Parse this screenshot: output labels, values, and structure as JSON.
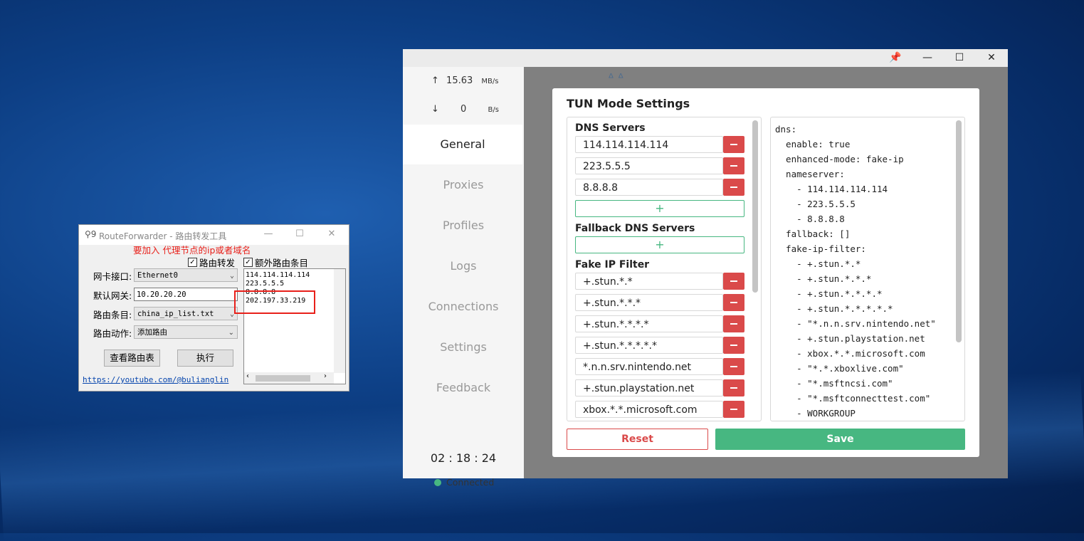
{
  "route_forwarder": {
    "title": "RouteForwarder - 路由转发工具",
    "annotation": "要加入 代理节点的ip或者域名",
    "checkbox_route_forward": "路由转发",
    "checkbox_extra_entries": "额外路由条目",
    "nic_label": "网卡接口:",
    "nic_value": "Ethernet0",
    "gateway_label": "默认网关:",
    "gateway_value": "10.20.20.20",
    "entries_label": "路由条目:",
    "entries_value": "china_ip_list.txt",
    "action_label": "路由动作:",
    "action_value": "添加路由",
    "extra_list": [
      "114.114.114.114",
      "223.5.5.5",
      "8.8.8.8",
      "202.197.33.219"
    ],
    "view_table_button": "查看路由表",
    "execute_button": "执行",
    "link": "https://youtube.com/@bulianglin"
  },
  "clash": {
    "speed_up": "15.63",
    "speed_up_unit": "MB/s",
    "speed_down": "0",
    "speed_down_unit": "B/s",
    "nav": [
      "General",
      "Proxies",
      "Profiles",
      "Logs",
      "Connections",
      "Settings",
      "Feedback"
    ],
    "active_nav": "General",
    "clock": "02 : 18 : 24",
    "status": "Connected",
    "modal": {
      "title": "TUN Mode Settings",
      "dns_servers_label": "DNS Servers",
      "dns_servers": [
        "114.114.114.114",
        "223.5.5.5",
        "8.8.8.8"
      ],
      "fallback_label": "Fallback DNS Servers",
      "fake_ip_filter_label": "Fake IP Filter",
      "fake_ip_filter": [
        "+.stun.*.*",
        "+.stun.*.*.*",
        "+.stun.*.*.*.*",
        "+.stun.*.*.*.*.*",
        "*.n.n.srv.nintendo.net",
        "+.stun.playstation.net",
        "xbox.*.*.microsoft.com"
      ],
      "plus_symbol": "+",
      "yaml_lines": [
        "dns:",
        "  enable: true",
        "  enhanced-mode: fake-ip",
        "  nameserver:",
        "    - 114.114.114.114",
        "    - 223.5.5.5",
        "    - 8.8.8.8",
        "  fallback: []",
        "  fake-ip-filter:",
        "    - +.stun.*.*",
        "    - +.stun.*.*.*",
        "    - +.stun.*.*.*.*",
        "    - +.stun.*.*.*.*.*",
        "    - \"*.n.n.srv.nintendo.net\"",
        "    - +.stun.playstation.net",
        "    - xbox.*.*.microsoft.com",
        "    - \"*.*.xboxlive.com\"",
        "    - \"*.msftncsi.com\"",
        "    - \"*.msftconnecttest.com\"",
        "    - WORKGROUP"
      ],
      "reset_button": "Reset",
      "save_button": "Save"
    }
  },
  "colors": {
    "accent_green": "#47b781",
    "danger_red": "#da4a4a",
    "annotation_red": "#e8201a"
  }
}
